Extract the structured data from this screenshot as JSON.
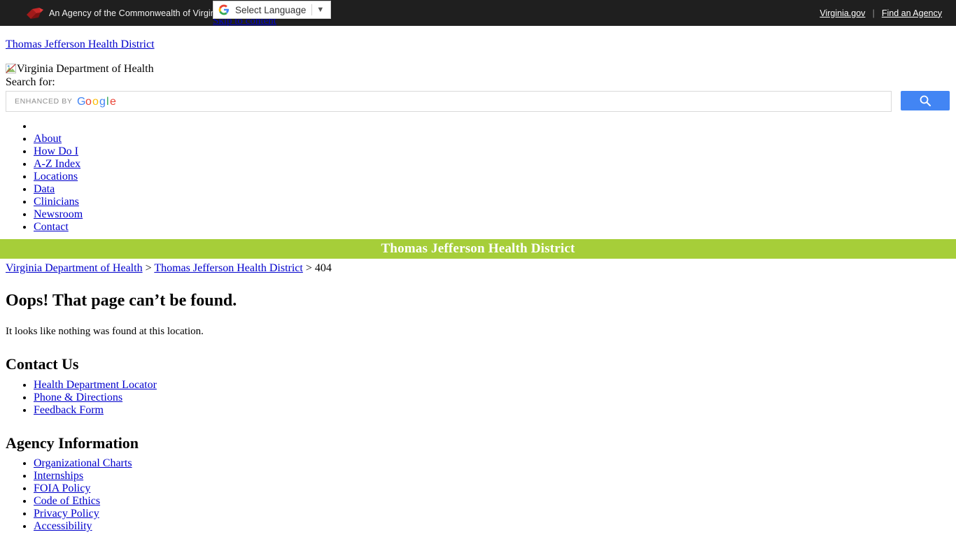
{
  "gov_bar": {
    "logo_icon": "virginia-seal-icon",
    "agency_text": "An Agency of the Commonwealth of Virginia",
    "separator": "|",
    "links": [
      {
        "label": "Virginia.gov",
        "name": "virginia-gov-link"
      },
      {
        "label": "Find an Agency",
        "name": "find-an-agency-link"
      }
    ]
  },
  "translate": {
    "icon": "google-g-icon",
    "label": "Select Language",
    "caret_icon": "chevron-down-icon",
    "caret_glyph": "▼"
  },
  "skip_link": {
    "label": "Skip to content"
  },
  "site": {
    "district_link": "Thomas Jefferson Health District",
    "logo_alt": "Virginia Department of Health",
    "broken_image_icon": "broken-image-icon"
  },
  "search": {
    "label": "Search for:",
    "enhanced_by": "ENHANCED BY",
    "google_wordmark": "Google",
    "value": "",
    "placeholder": "",
    "button_icon": "search-icon"
  },
  "nav": {
    "items": [
      {
        "label": "",
        "name": "nav-item-home",
        "empty": true
      },
      {
        "label": "About",
        "name": "nav-item-about"
      },
      {
        "label": "How Do I",
        "name": "nav-item-how-do-i"
      },
      {
        "label": "A-Z Index",
        "name": "nav-item-a-z-index"
      },
      {
        "label": "Locations",
        "name": "nav-item-locations"
      },
      {
        "label": "Data",
        "name": "nav-item-data"
      },
      {
        "label": "Clinicians",
        "name": "nav-item-clinicians"
      },
      {
        "label": "Newsroom",
        "name": "nav-item-newsroom"
      },
      {
        "label": "Contact",
        "name": "nav-item-contact"
      }
    ]
  },
  "district_banner": {
    "title": "Thomas Jefferson Health District",
    "background_color": "#a6ce39",
    "text_color": "#ffffff"
  },
  "breadcrumb": {
    "items": [
      {
        "label": "Virginia Department of Health",
        "link": true
      },
      {
        "label": "Thomas Jefferson Health District",
        "link": true
      },
      {
        "label": "404",
        "link": false
      }
    ],
    "separator": ">"
  },
  "main": {
    "heading": "Oops! That page can’t be found.",
    "body_text": "It looks like nothing was found at this location."
  },
  "contact_section": {
    "heading": "Contact Us",
    "items": [
      {
        "label": "Health Department Locator",
        "name": "health-department-locator-link"
      },
      {
        "label": "Phone & Directions",
        "name": "phone-and-directions-link"
      },
      {
        "label": "Feedback Form",
        "name": "feedback-form-link"
      }
    ]
  },
  "agency_section": {
    "heading": "Agency Information",
    "items": [
      {
        "label": "Organizational Charts",
        "name": "organizational-charts-link"
      },
      {
        "label": "Internships",
        "name": "internships-link"
      },
      {
        "label": "FOIA Policy",
        "name": "foia-policy-link"
      },
      {
        "label": "Code of Ethics",
        "name": "code-of-ethics-link"
      },
      {
        "label": "Privacy Policy",
        "name": "privacy-policy-link"
      },
      {
        "label": "Accessibility",
        "name": "accessibility-link"
      }
    ]
  },
  "colors": {
    "gov_bar_background": "#1f1f1f",
    "link": "#0000cc",
    "banner_green": "#a6ce39",
    "search_button_blue": "#4285f4"
  }
}
